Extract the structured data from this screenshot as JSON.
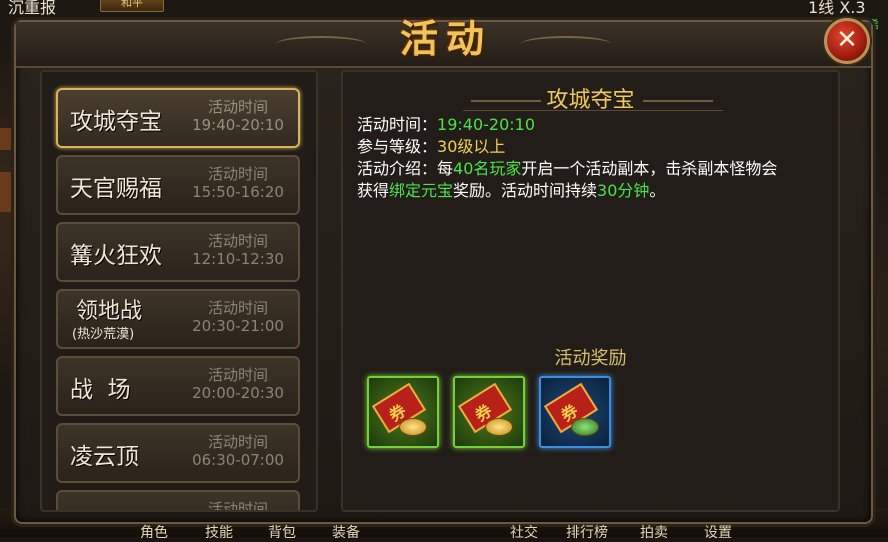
{
  "background": {
    "top_left_name": "沉重报",
    "top_tag": "和平",
    "top_right_line": "1线 X.3",
    "top_right_green": "(稀"
  },
  "dialog": {
    "title": "活动",
    "close_symbol": "✕"
  },
  "activities": [
    {
      "name": "攻城夺宝",
      "sub": "",
      "time_label": "活动时间",
      "time": "19:40-20:10",
      "selected": true
    },
    {
      "name": "天官赐福",
      "sub": "",
      "time_label": "活动时间",
      "time": "15:50-16:20",
      "selected": false
    },
    {
      "name": "篝火狂欢",
      "sub": "",
      "time_label": "活动时间",
      "time": "12:10-12:30",
      "selected": false
    },
    {
      "name": "领地战",
      "sub": "(热沙荒漠)",
      "time_label": "活动时间",
      "time": "20:30-21:00",
      "selected": false
    },
    {
      "name": "战  场",
      "sub": "",
      "time_label": "活动时间",
      "time": "20:00-20:30",
      "selected": false
    },
    {
      "name": "凌云顶",
      "sub": "",
      "time_label": "活动时间",
      "time": "06:30-07:00",
      "selected": false
    },
    {
      "name": "",
      "sub": "",
      "time_label": "活动时间",
      "time": "",
      "selected": false
    }
  ],
  "detail": {
    "title": "攻城夺宝",
    "time_label": "活动时间：",
    "time_value": "19:40-20:10",
    "level_label": "参与等级：",
    "level_value": "30级以上",
    "intro_label": "活动介绍：每",
    "intro_count": "40名玩家",
    "intro_mid": "开启一个活动副本，击杀副本怪物会",
    "intro_line2_pre": "获得",
    "intro_reward": "绑定元宝",
    "intro_line2_mid": "奖励。活动时间持续",
    "intro_duration": "30分钟",
    "intro_end": "。"
  },
  "rewards": {
    "title": "活动奖励",
    "items": [
      {
        "icon": "bound-gold-ticket-icon",
        "quality": "green",
        "glyph": "券"
      },
      {
        "icon": "bound-gold-ticket-icon",
        "quality": "green",
        "glyph": "券"
      },
      {
        "icon": "gold-ticket-bag-icon",
        "quality": "blue",
        "glyph": "券"
      }
    ]
  },
  "bottom_bar": [
    "角色",
    "技能",
    "背包",
    "装备",
    "社交",
    "排行榜",
    "拍卖",
    "设置"
  ],
  "colors": {
    "accent_gold": "#efc95e",
    "highlight_green": "#4be34b",
    "highlight_yellow": "#f0d24d",
    "close_red": "#c8321c"
  }
}
